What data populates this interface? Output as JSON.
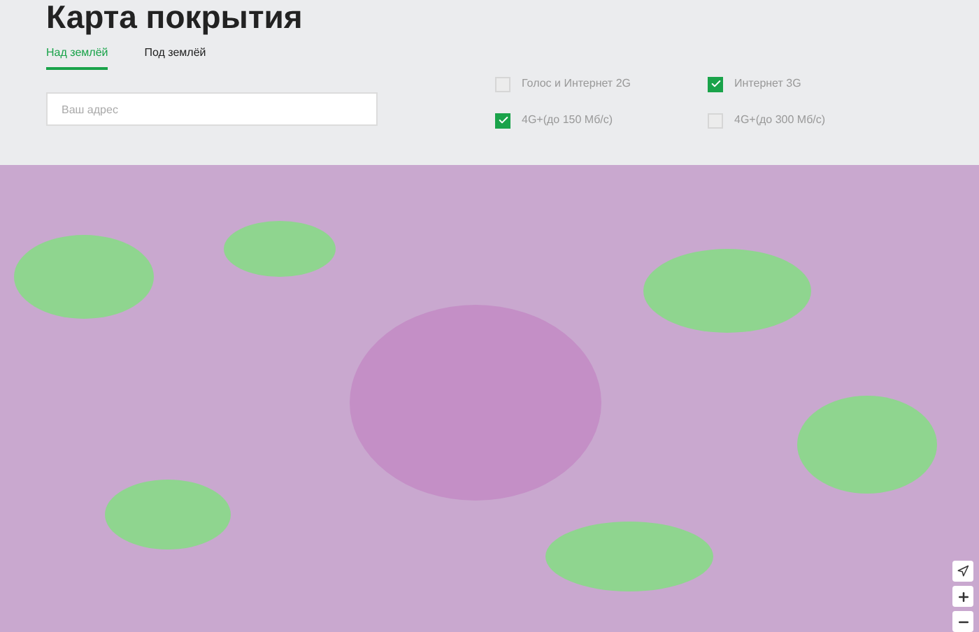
{
  "title": "Карта покрытия",
  "tabs": [
    {
      "label": "Над землёй",
      "selected": true
    },
    {
      "label": "Под землёй",
      "selected": false
    }
  ],
  "search": {
    "placeholder": "Ваш адрес"
  },
  "filters": [
    {
      "label": "Голос и Интернет 2G",
      "checked": false
    },
    {
      "label": "Интернет 3G",
      "checked": true
    },
    {
      "label": "4G+(до 150 Мб/с)",
      "checked": true
    },
    {
      "label": "4G+(до 300 Мб/с)",
      "checked": false
    }
  ]
}
